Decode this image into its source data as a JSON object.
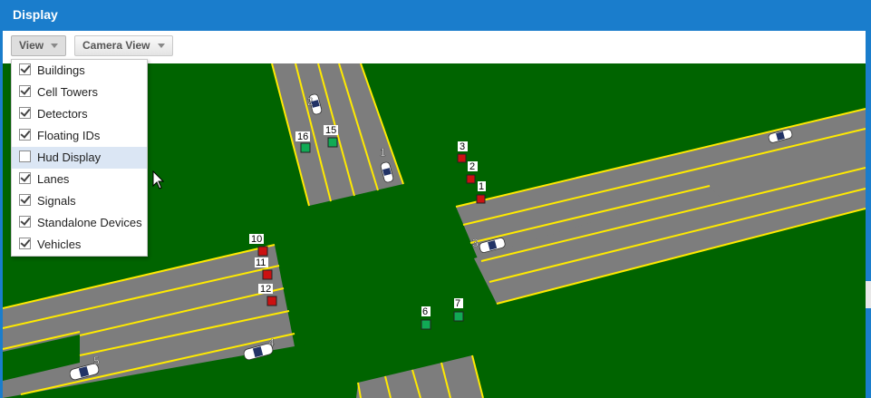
{
  "window": {
    "title": "Display"
  },
  "toolbar": {
    "view_label": "View",
    "camera_label": "Camera View"
  },
  "menu": {
    "items": [
      {
        "label": "Buildings",
        "checked": true
      },
      {
        "label": "Cell Towers",
        "checked": true
      },
      {
        "label": "Detectors",
        "checked": true
      },
      {
        "label": "Floating IDs",
        "checked": true
      },
      {
        "label": "Hud Display",
        "checked": false
      },
      {
        "label": "Lanes",
        "checked": true
      },
      {
        "label": "Signals",
        "checked": true
      },
      {
        "label": "Standalone Devices",
        "checked": true
      },
      {
        "label": "Vehicles",
        "checked": true
      }
    ]
  },
  "signals": [
    {
      "id": "16",
      "state": "green"
    },
    {
      "id": "15",
      "state": "green"
    },
    {
      "id": "3",
      "state": "red"
    },
    {
      "id": "2",
      "state": "red"
    },
    {
      "id": "1",
      "state": "red"
    },
    {
      "id": "10",
      "state": "red"
    },
    {
      "id": "11",
      "state": "red"
    },
    {
      "id": "12",
      "state": "red"
    },
    {
      "id": "6",
      "state": "green"
    },
    {
      "id": "7",
      "state": "green"
    }
  ],
  "vehicles": [
    {
      "id": "1"
    },
    {
      "id": "2"
    },
    {
      "id": "3"
    },
    {
      "id": "4"
    },
    {
      "id": "5"
    }
  ],
  "colors": {
    "titlebar": "#1a7dcc",
    "grass": "#006400",
    "road": "#7d7d7d",
    "lane_line": "#ffea00",
    "signal_red": "#cc1111",
    "signal_green": "#11aa55"
  }
}
